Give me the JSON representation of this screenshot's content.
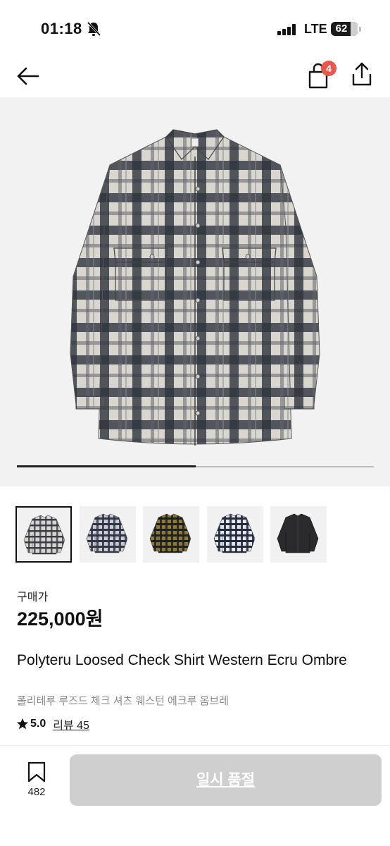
{
  "status_bar": {
    "time": "01:18",
    "network": "LTE",
    "battery_percent": "62",
    "battery_level": 0.62,
    "icons": [
      "bell-off-icon",
      "signal-icon",
      "battery-icon"
    ]
  },
  "nav": {
    "back_icon": "arrow-left-icon",
    "cart_icon": "shopping-bag-icon",
    "cart_badge": "4",
    "share_icon": "share-icon",
    "badge_color": "#e8564d"
  },
  "gallery": {
    "image": "plaid-shirt-front",
    "progress": 0.5
  },
  "thumbnails": [
    {
      "image": "grey-plaid-shirt",
      "selected": true
    },
    {
      "image": "navy-plaid-shirt",
      "selected": false
    },
    {
      "image": "olive-plaid-shirt",
      "selected": false
    },
    {
      "image": "blue-plaid-shirt",
      "selected": false
    },
    {
      "image": "black-shirt",
      "selected": false
    }
  ],
  "price": {
    "label": "구매가",
    "value": "225,000원"
  },
  "product": {
    "title_en": "Polyteru Loosed Check Shirt Western Ecru Ombre",
    "title_ko": "폴리테루 루즈드 체크 셔츠 웨스턴 에크루 옴브레",
    "rating": "5.0",
    "review_text": "리뷰 45"
  },
  "bottom_bar": {
    "bookmark_icon": "bookmark-icon",
    "bookmark_count": "482",
    "buy_button_label": "일시 품절",
    "buy_button_color": "#cfcfcf"
  }
}
